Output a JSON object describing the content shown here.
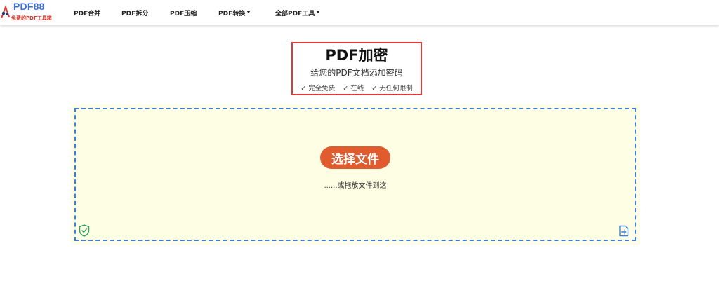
{
  "header": {
    "logo_title": "PDF88",
    "logo_subtitle": "免费的PDF工具箱",
    "nav": [
      {
        "label": "PDF合并"
      },
      {
        "label": "PDF拆分"
      },
      {
        "label": "PDF压缩"
      },
      {
        "label": "PDF转换"
      },
      {
        "label": "全部PDF工具"
      }
    ]
  },
  "hero": {
    "title": "PDF加密",
    "subtitle": "给您的PDF文档添加密码",
    "features": [
      "✓ 完全免费",
      "✓ 在线",
      "✓ 无任何限制"
    ]
  },
  "upload": {
    "button_label": "选择文件",
    "hint": "......或拖放文件到这"
  },
  "colors": {
    "brand_blue": "#3b6fd4",
    "accent_red": "#d9372b",
    "button_orange": "#e05c2e",
    "dropzone_bg": "#fefee4",
    "dash_blue": "#3d7dd8",
    "shield_green": "#2aa05a"
  },
  "icons": {
    "logo": "pdf88-logo-icon",
    "shield": "shield-check-icon",
    "add_file": "file-plus-icon",
    "caret": "caret-down-icon"
  }
}
